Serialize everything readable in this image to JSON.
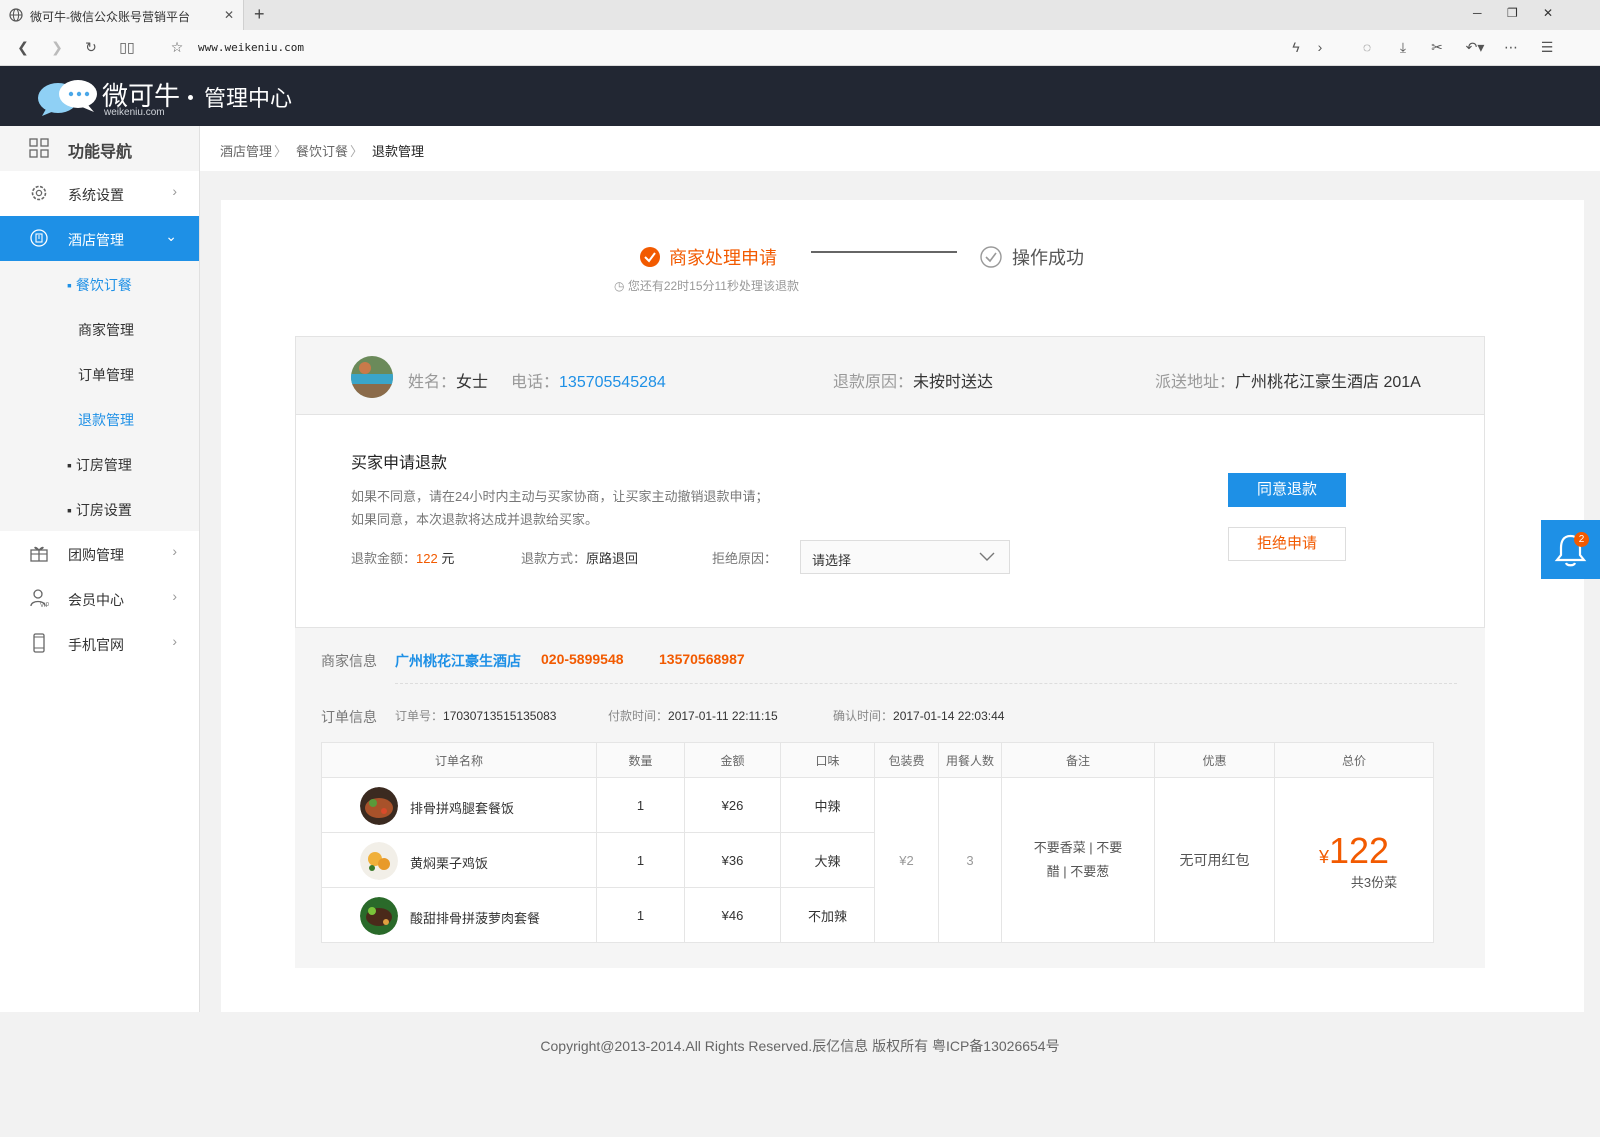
{
  "browser": {
    "tab_title": "微可牛-微信公众账号营销平台",
    "url": "www.weikeniu.com"
  },
  "header": {
    "brand": "微可牛",
    "brand_domain": "weikeniu.com",
    "center_title": "管理中心"
  },
  "sidebar": {
    "head_label": "功能导航",
    "items": [
      {
        "label": "系统设置"
      },
      {
        "label": "酒店管理"
      },
      {
        "label": "团购管理"
      },
      {
        "label": "会员中心"
      },
      {
        "label": "手机官网"
      }
    ],
    "sub_items": [
      {
        "label": "▪ 餐饮订餐"
      },
      {
        "label": "商家管理"
      },
      {
        "label": "订单管理"
      },
      {
        "label": "退款管理"
      },
      {
        "label": "▪ 订房管理"
      },
      {
        "label": "▪ 订房设置"
      }
    ]
  },
  "breadcrumb": {
    "items": [
      "酒店管理",
      "餐饮订餐",
      "退款管理"
    ]
  },
  "progress": {
    "step1": "商家处理申请",
    "step2": "操作成功",
    "tip": "您还有22时15分11秒处理该退款"
  },
  "customer": {
    "name_label": "姓名：",
    "name": "女士",
    "phone_label": "电话：",
    "phone": "135705545284",
    "reason_label": "退款原因：",
    "reason": "未按时送达",
    "address_label": "派送地址：",
    "address": "广州桃花江豪生酒店 201A"
  },
  "refund": {
    "title": "买家申请退款",
    "line1": "如果不同意，请在24小时内主动与买家协商，让买家主动撤销退款申请；",
    "line2": "如果同意，本次退款将达成并退款给买家。",
    "amount_label": "退款金额：",
    "amount": "122",
    "amount_unit": " 元",
    "method_label": "退款方式：",
    "method": "原路退回",
    "reject_label": "拒绝原因：",
    "reject_placeholder": "请选择",
    "agree_btn": "同意退款",
    "reject_btn": "拒绝申请"
  },
  "merchant": {
    "label": "商家信息",
    "name": "广州桃花江豪生酒店",
    "tel1": "020-5899548",
    "tel2": "13570568987"
  },
  "order": {
    "label": "订单信息",
    "no_label": "订单号：",
    "no": "17030713515135083",
    "pay_label": "付款时间：",
    "pay_time": "2017-01-11 22:11:15",
    "confirm_label": "确认时间：",
    "confirm_time": "2017-01-14 22:03:44",
    "columns": [
      "订单名称",
      "数量",
      "金额",
      "口味",
      "包装费",
      "用餐人数",
      "备注",
      "优惠",
      "总价"
    ],
    "rows": [
      {
        "name": "排骨拼鸡腿套餐饭",
        "qty": "1",
        "amount": "¥26",
        "taste": "中辣"
      },
      {
        "name": "黄焖栗子鸡饭",
        "qty": "1",
        "amount": "¥36",
        "taste": "大辣"
      },
      {
        "name": "酸甜排骨拼菠萝肉套餐",
        "qty": "1",
        "amount": "¥46",
        "taste": "不加辣"
      }
    ],
    "package_fee": "¥2",
    "diners": "3",
    "note": "不要香菜 | 不要醋 | 不要葱",
    "discount": "无可用红包",
    "total_symbol": "¥",
    "total": "122",
    "total_count": "共3份菜"
  },
  "footer": "Copyright@2013-2014.All Rights Reserved.辰亿信息 版权所有 粤ICP备13026654号",
  "notify": {
    "count": "2"
  },
  "colors": {
    "accent": "#1e90e6",
    "orange": "#f25a00",
    "header_bg": "#222733"
  }
}
